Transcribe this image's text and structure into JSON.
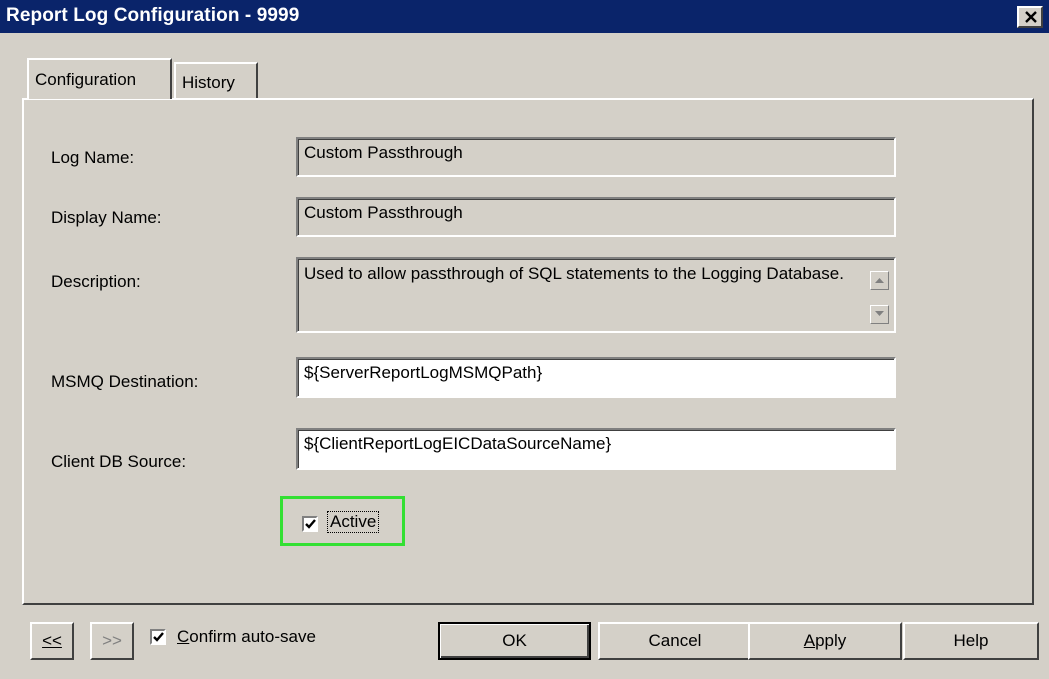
{
  "window": {
    "title": "Report Log Configuration - 9999",
    "close_label": "✕"
  },
  "tabs": [
    {
      "label": "Configuration",
      "selected": true
    },
    {
      "label": "History",
      "selected": false
    }
  ],
  "form": {
    "log_name": {
      "label": "Log Name:",
      "value": "Custom Passthrough"
    },
    "display_name": {
      "label": "Display Name:",
      "value": "Custom Passthrough"
    },
    "description": {
      "label": "Description:",
      "value": "Used to allow passthrough of SQL statements to the Logging Database."
    },
    "msmq_destination": {
      "label": "MSMQ Destination:",
      "value": "${ServerReportLogMSMQPath}"
    },
    "client_db_source": {
      "label": "Client DB Source:",
      "value": "${ClientReportLogEICDataSourceName}"
    },
    "active": {
      "label": "Active",
      "checked": true
    }
  },
  "footer": {
    "prev_label": "<<",
    "next_label": ">>",
    "confirm_autosave": {
      "label_first": "C",
      "label_rest": "onfirm auto-save",
      "checked": true
    },
    "ok_label": "OK",
    "cancel_label": "Cancel",
    "apply_first": "A",
    "apply_rest": "pply",
    "help_label": "Help"
  },
  "colors": {
    "titlebar": "#0a246a",
    "face": "#d4d0c8",
    "highlight_box": "#33e033"
  }
}
